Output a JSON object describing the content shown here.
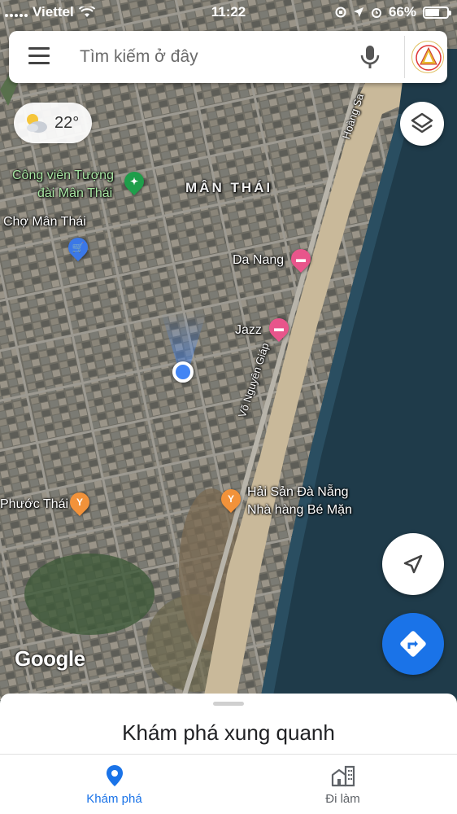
{
  "status_bar": {
    "carrier": "Viettel",
    "time": "11:22",
    "battery": "66%",
    "battery_level": 0.66
  },
  "search": {
    "placeholder": "Tìm kiếm ở đây"
  },
  "weather": {
    "temperature": "22°",
    "icon": "partly-cloudy-icon"
  },
  "map": {
    "labels": {
      "park_line1": "Công viên Tượng",
      "park_line2": "đài Mân Thái",
      "market": "Chợ Mân Thái",
      "area": "MÂN THÁI",
      "hotel1": "Da Nang",
      "hotel2": "Jazz",
      "street1": "Võ Nguyên Giáp",
      "street2": "Hoàng Sa",
      "restaurant_area": "Phước Thái",
      "restaurant_line1": "Hải Sản Đà Nẵng",
      "restaurant_line2": "Nhà hàng Bé Mặn"
    },
    "logo": "Google",
    "colors": {
      "sea": "#1f3b4a",
      "beach": "#c9b99a",
      "city": "#6b6a62"
    }
  },
  "bottom_sheet": {
    "title": "Khám phá xung quanh"
  },
  "bottom_nav": {
    "items": [
      {
        "label": "Khám phá",
        "icon": "location-pin-icon",
        "active": true
      },
      {
        "label": "Đi làm",
        "icon": "commute-buildings-icon",
        "active": false
      }
    ]
  },
  "colors": {
    "accent": "#1a73e8"
  }
}
